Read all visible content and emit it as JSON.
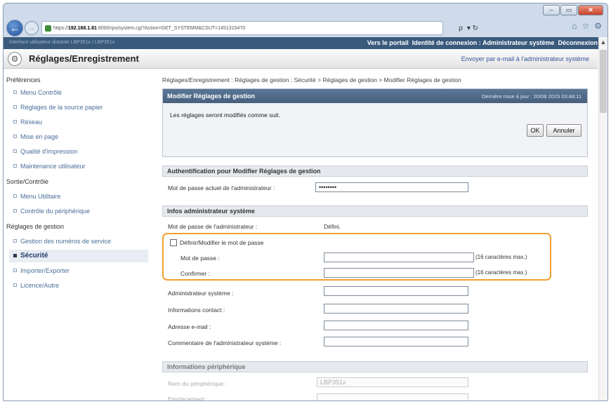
{
  "browser": {
    "address": {
      "prefix": "https://",
      "host": "192.168.1.81",
      "rest": ":8000/rps/system.cgi?Action=GET_SYSTEMM&CSUT=1451315470"
    },
    "address_tools": {
      "search": "ρ",
      "refresh": "▾ ↻"
    },
    "icons": [
      "home-icon",
      "star-icon",
      "settings-icon"
    ]
  },
  "top_strip": {
    "left_text": "Interface utilisateur distante                 LBP351x / LBP351x",
    "links": [
      "Vers le portail",
      "Identité de connexion : Administrateur système",
      "Déconnexion"
    ]
  },
  "header": {
    "title": "Réglages/Enregistrement",
    "email_link": "Envoyer par e-mail à l'administrateur système"
  },
  "sidebar": {
    "groups": [
      {
        "title": "Préférences",
        "items": [
          "Menu Contrôle",
          "Réglages de la source papier",
          "Réseau",
          "Mise en page",
          "Qualité d'impression",
          "Maintenance utilisateur"
        ]
      },
      {
        "title": "Sortie/Contrôle",
        "items": [
          "Menu Utilitaire",
          "Contrôle du périphérique"
        ]
      },
      {
        "title": "Réglages de gestion",
        "items": [
          "Gestion des numéros de service",
          "Sécurité",
          "Importer/Exporter",
          "Licence/Autre"
        ]
      }
    ]
  },
  "breadcrumb": "Réglages/Enregistrement : Réglages de gestion : Sécurité > Réglages de gestion > Modifier Réglages de gestion",
  "panel": {
    "title": "Modifier Réglages de gestion",
    "last_update": "Dernière mise à jour : 20/08 2015 03:48:11",
    "message": "Les réglages seront modifiés comme suit.",
    "ok": "OK",
    "cancel": "Annuler"
  },
  "auth": {
    "title": "Authentification pour Modifier Réglages de gestion",
    "label": "Mot de passe actuel de l'administrateur :",
    "value": "••••••••"
  },
  "admin": {
    "title": "Infos administrateur système",
    "pw_label": "Mot de passe de l'administrateur :",
    "pw_status": "Défini.",
    "change_cb": "Définir/Modifier le mot de passe",
    "new_pw_label": "Mot de passe :",
    "confirm_label": "Confirmer :",
    "max_note": "(16 caractères max.)",
    "sysadmin_label": "Administrateur système :",
    "contact_label": "Informations contact :",
    "email_label": "Adresse e-mail :",
    "comment_label": "Commentaire de l'administrateur système :"
  },
  "device": {
    "title": "Informations périphérique",
    "name_label": "Nom du périphérique :",
    "name_value": "LBP351x",
    "location_label": "Emplacement :"
  },
  "colors": {
    "highlight": "#f0a030",
    "panel_bar": "#4f6a89",
    "link": "#4a6e99"
  }
}
